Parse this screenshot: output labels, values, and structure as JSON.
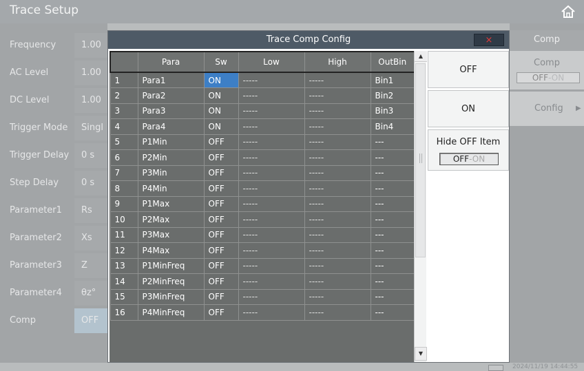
{
  "app": {
    "title": "Trace Setup",
    "timestamp": "2024/11/19 14:44:55"
  },
  "left_panel": {
    "items": [
      {
        "label": "Frequency",
        "value": "1.00"
      },
      {
        "label": "AC Level",
        "value": "1.00"
      },
      {
        "label": "DC Level",
        "value": "1.00"
      },
      {
        "label": "Trigger Mode",
        "value": "Singl"
      },
      {
        "label": "Trigger Delay",
        "value": "0 s"
      },
      {
        "label": "Step Delay",
        "value": "0 s"
      },
      {
        "label": "Parameter1",
        "value": "Rs"
      },
      {
        "label": "Parameter2",
        "value": "Xs"
      },
      {
        "label": "Parameter3",
        "value": "Z"
      },
      {
        "label": "Parameter4",
        "value": "θz°"
      },
      {
        "label": "Comp",
        "value": "OFF"
      }
    ]
  },
  "right_panel": {
    "title": "Comp",
    "comp_label": "Comp",
    "comp_toggle_on": "OFF",
    "comp_toggle_off": "-ON",
    "config_label": "Config",
    "config_arrow": "▶"
  },
  "dialog": {
    "title": "Trace Comp Config",
    "close": "×",
    "columns": [
      "",
      "Para",
      "Sw",
      "Low",
      "High",
      "OutBin"
    ],
    "rows": [
      [
        "1",
        "Para1",
        "ON",
        "-----",
        "-----",
        "Bin1"
      ],
      [
        "2",
        "Para2",
        "ON",
        "-----",
        "-----",
        "Bin2"
      ],
      [
        "3",
        "Para3",
        "ON",
        "-----",
        "-----",
        "Bin3"
      ],
      [
        "4",
        "Para4",
        "ON",
        "-----",
        "-----",
        "Bin4"
      ],
      [
        "5",
        "P1Min",
        "OFF",
        "-----",
        "-----",
        "---"
      ],
      [
        "6",
        "P2Min",
        "OFF",
        "-----",
        "-----",
        "---"
      ],
      [
        "7",
        "P3Min",
        "OFF",
        "-----",
        "-----",
        "---"
      ],
      [
        "8",
        "P4Min",
        "OFF",
        "-----",
        "-----",
        "---"
      ],
      [
        "9",
        "P1Max",
        "OFF",
        "-----",
        "-----",
        "---"
      ],
      [
        "10",
        "P2Max",
        "OFF",
        "-----",
        "-----",
        "---"
      ],
      [
        "11",
        "P3Max",
        "OFF",
        "-----",
        "-----",
        "---"
      ],
      [
        "12",
        "P4Max",
        "OFF",
        "-----",
        "-----",
        "---"
      ],
      [
        "13",
        "P1MinFreq",
        "OFF",
        "-----",
        "-----",
        "---"
      ],
      [
        "14",
        "P2MinFreq",
        "OFF",
        "-----",
        "-----",
        "---"
      ],
      [
        "15",
        "P3MinFreq",
        "OFF",
        "-----",
        "-----",
        "---"
      ],
      [
        "16",
        "P4MinFreq",
        "OFF",
        "-----",
        "-----",
        "---"
      ]
    ],
    "selected_color": "#3d7fc6",
    "buttons": {
      "off": "OFF",
      "on": "ON",
      "hide_label": "Hide OFF Item",
      "hide_toggle_on": "OFF",
      "hide_toggle_off": "-ON"
    }
  },
  "icons": {
    "home": "home-icon",
    "usb": "usb-icon"
  }
}
